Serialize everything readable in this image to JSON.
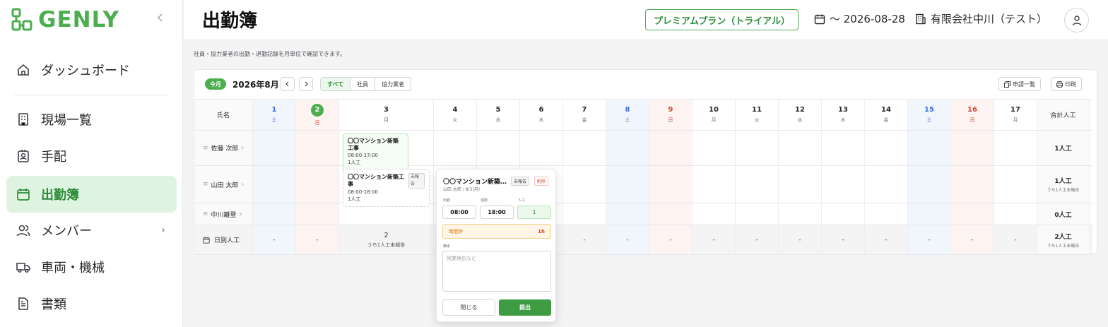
{
  "app": {
    "logo": "GENLY",
    "brand_color": "#4cae4f"
  },
  "sidebar": {
    "items": [
      {
        "label": "ダッシュボード",
        "icon": "home-icon"
      },
      {
        "label": "現場一覧",
        "icon": "building-icon"
      },
      {
        "label": "手配",
        "icon": "badge-icon"
      },
      {
        "label": "出勤簿",
        "icon": "calendar-icon",
        "active": true
      },
      {
        "label": "メンバー",
        "icon": "users-icon",
        "has_submenu": true
      },
      {
        "label": "車両・機械",
        "icon": "truck-icon"
      },
      {
        "label": "書類",
        "icon": "document-icon"
      }
    ]
  },
  "header": {
    "title": "出勤簿",
    "plan": "プレミアムプラン（トライアル）",
    "date": "〜 2026-08-28",
    "company": "有限会社中川（テスト）"
  },
  "description": "社員・協力業者の出勤・退勤記録を月単位で確認できます。",
  "toolbar": {
    "today": "今月",
    "month": "2026年8月",
    "prev": "<",
    "next": ">",
    "filters": [
      "すべて",
      "社員",
      "協力業者"
    ],
    "active_filter": 0,
    "requests": "申請一覧",
    "print": "印刷"
  },
  "table": {
    "name_header": "氏名",
    "total_header": "合計人工",
    "days": [
      {
        "d": "1",
        "w": "土",
        "type": "sat"
      },
      {
        "d": "2",
        "w": "日",
        "type": "sun",
        "today": true
      },
      {
        "d": "3",
        "w": "月",
        "type": ""
      },
      {
        "d": "4",
        "w": "火",
        "type": ""
      },
      {
        "d": "5",
        "w": "水",
        "type": ""
      },
      {
        "d": "6",
        "w": "木",
        "type": ""
      },
      {
        "d": "7",
        "w": "金",
        "type": ""
      },
      {
        "d": "8",
        "w": "土",
        "type": "sat"
      },
      {
        "d": "9",
        "w": "日",
        "type": "sun"
      },
      {
        "d": "10",
        "w": "月",
        "type": ""
      },
      {
        "d": "11",
        "w": "火",
        "type": ""
      },
      {
        "d": "12",
        "w": "水",
        "type": ""
      },
      {
        "d": "13",
        "w": "木",
        "type": ""
      },
      {
        "d": "14",
        "w": "金",
        "type": ""
      },
      {
        "d": "15",
        "w": "土",
        "type": "sat"
      },
      {
        "d": "16",
        "w": "日",
        "type": "sun"
      },
      {
        "d": "17",
        "w": "月",
        "type": ""
      }
    ],
    "rows": [
      {
        "name": "佐藤 次郎",
        "total": "1人工",
        "total_sub": "",
        "entry": {
          "site": "〇〇マンション新築工事",
          "time": "08:00-17:00",
          "work": "1人工",
          "tag": ""
        }
      },
      {
        "name": "山田 太郎",
        "total": "1人工",
        "total_sub": "うち1人工未報告",
        "entry": {
          "site": "〇〇マンション新築工事",
          "time": "08:00-18:00",
          "work": "1人工",
          "tag": "未報告"
        }
      },
      {
        "name": "中川離登",
        "total": "0人工",
        "total_sub": "",
        "entry": null
      }
    ],
    "daily": {
      "label": "日別人工",
      "values": [
        "-",
        "-",
        "2",
        "",
        "",
        "",
        "-",
        "-",
        "-",
        "-",
        "-",
        "-",
        "-",
        "-",
        "-",
        "-",
        "-"
      ],
      "day3_sub": "うち1人工未報告",
      "total": "2人工",
      "total_sub": "うち1人工未報告"
    }
  },
  "popover": {
    "title": "〇〇マンション新築工事",
    "tag": "未報告",
    "delete": "削除",
    "subtitle": "山田 太郎 / 8/3(月)",
    "in_label": "出勤",
    "out_label": "退勤",
    "work_label": "人工",
    "in_value": "08:00",
    "out_value": "18:00",
    "work_value": "1",
    "overtime_label": "時間外",
    "overtime_value": "1h",
    "note_label": "備考",
    "note_placeholder": "残業理由など",
    "close": "閉じる",
    "submit": "提出"
  }
}
